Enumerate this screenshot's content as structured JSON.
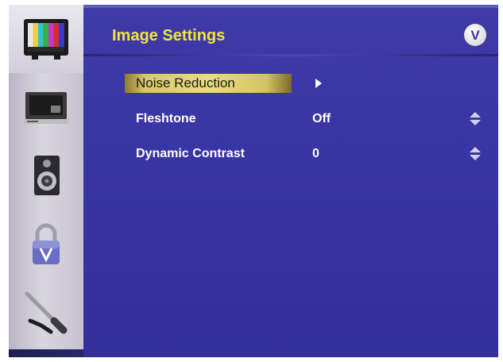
{
  "menu": {
    "title": "Image Settings",
    "logo_text": "V",
    "items": [
      {
        "label": "Noise Reduction",
        "value": "",
        "submenu": true
      },
      {
        "label": "Fleshtone",
        "value": "Off"
      },
      {
        "label": "Dynamic Contrast",
        "value": "0"
      }
    ]
  },
  "rail": {
    "icons": [
      "tv-color-bars-icon",
      "monitor-icon",
      "speaker-icon",
      "padlock-icon",
      "wrench-icon"
    ]
  },
  "colors": {
    "panel": "#3a35a4",
    "title": "#f2e43c",
    "highlight": "#eadd7c"
  }
}
